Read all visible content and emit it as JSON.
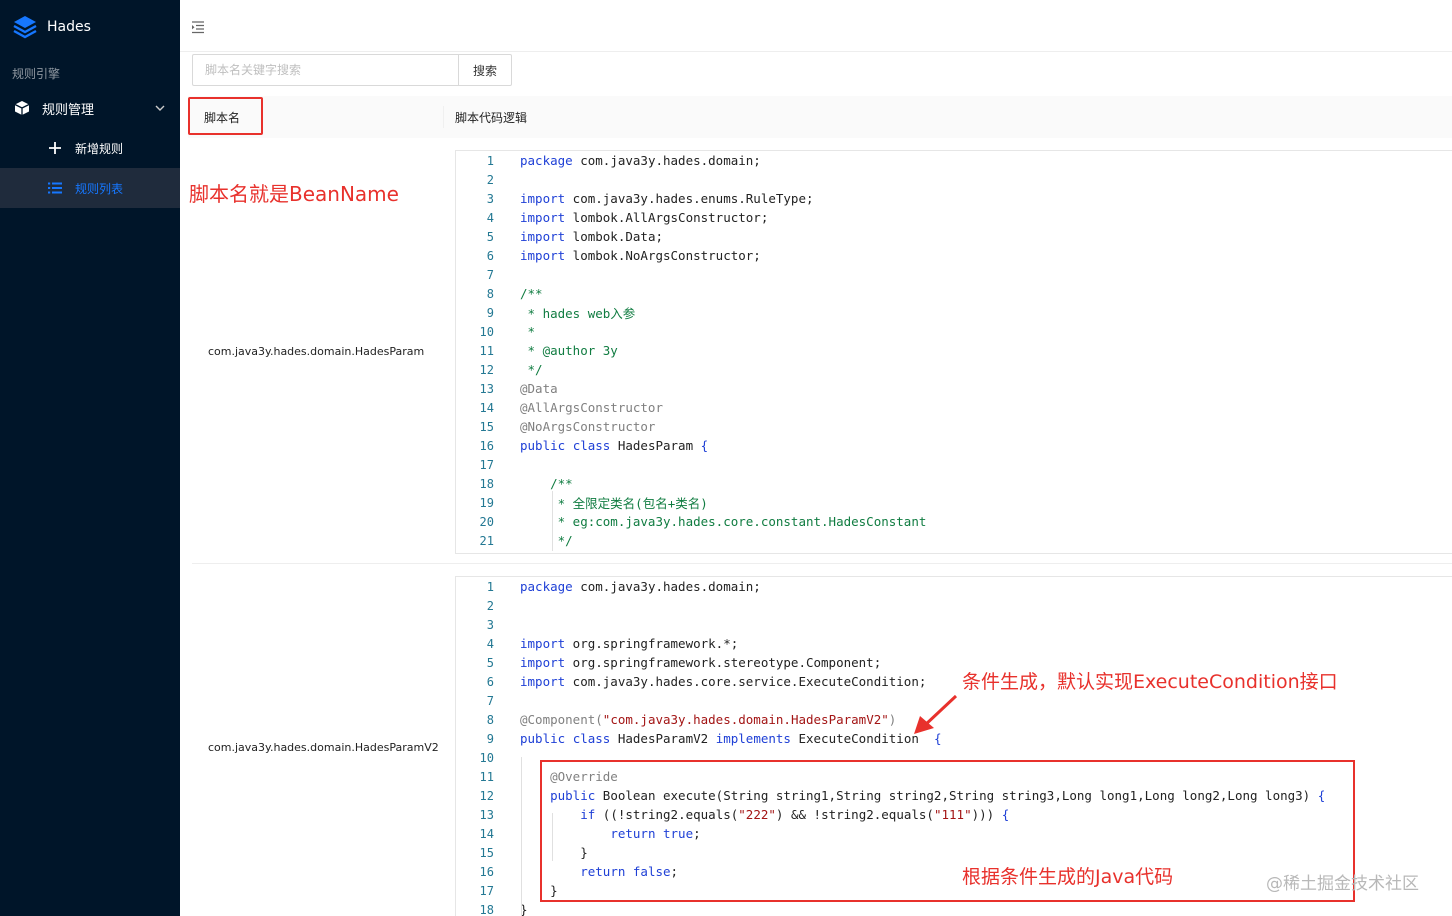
{
  "sidebar": {
    "brand": "Hades",
    "section": "规则引擎",
    "group": "规则管理",
    "items": [
      {
        "label": "新增规则"
      },
      {
        "label": "规则列表"
      }
    ]
  },
  "search": {
    "placeholder": "脚本名关键字搜索",
    "button": "搜索"
  },
  "table": {
    "col_name": "脚本名",
    "col_code": "脚本代码逻辑",
    "rows": [
      {
        "name": "com.java3y.hades.domain.HadesParam",
        "lines": [
          [
            {
              "t": "package",
              "c": "kw"
            },
            {
              "t": " com.java3y.hades.domain;"
            }
          ],
          [],
          [
            {
              "t": "import",
              "c": "kw"
            },
            {
              "t": " com.java3y.hades.enums.RuleType;"
            }
          ],
          [
            {
              "t": "import",
              "c": "kw"
            },
            {
              "t": " lombok.AllArgsConstructor;"
            }
          ],
          [
            {
              "t": "import",
              "c": "kw"
            },
            {
              "t": " lombok.Data;"
            }
          ],
          [
            {
              "t": "import",
              "c": "kw"
            },
            {
              "t": " lombok.NoArgsConstructor;"
            }
          ],
          [],
          [
            {
              "t": "/**",
              "c": "cm"
            }
          ],
          [
            {
              "t": " * hades web入参",
              "c": "cm"
            }
          ],
          [
            {
              "t": " *",
              "c": "cm"
            }
          ],
          [
            {
              "t": " * @author 3y",
              "c": "cm"
            }
          ],
          [
            {
              "t": " */",
              "c": "cm"
            }
          ],
          [
            {
              "t": "@Data",
              "c": "an"
            }
          ],
          [
            {
              "t": "@AllArgsConstructor",
              "c": "an"
            }
          ],
          [
            {
              "t": "@NoArgsConstructor",
              "c": "an"
            }
          ],
          [
            {
              "t": "public",
              "c": "kw"
            },
            {
              "t": " "
            },
            {
              "t": "class",
              "c": "kw"
            },
            {
              "t": " HadesParam "
            },
            {
              "t": "{",
              "c": "kw"
            }
          ],
          [],
          [
            {
              "t": "    /**",
              "c": "cm"
            }
          ],
          [
            {
              "t": "     * 全限定类名(包名+类名)",
              "c": "cm"
            }
          ],
          [
            {
              "t": "     * eg:com.java3y.hades.core.constant.HadesConstant",
              "c": "cm"
            }
          ],
          [
            {
              "t": "     */",
              "c": "cm"
            }
          ]
        ]
      },
      {
        "name": "com.java3y.hades.domain.HadesParamV2",
        "lines": [
          [
            {
              "t": "package",
              "c": "kw"
            },
            {
              "t": " com.java3y.hades.domain;"
            }
          ],
          [],
          [],
          [
            {
              "t": "import",
              "c": "kw"
            },
            {
              "t": " org.springframework.*;"
            }
          ],
          [
            {
              "t": "import",
              "c": "kw"
            },
            {
              "t": " org.springframework.stereotype.Component;"
            }
          ],
          [
            {
              "t": "import",
              "c": "kw"
            },
            {
              "t": " com.java3y.hades.core.service.ExecuteCondition;"
            }
          ],
          [],
          [
            {
              "t": "@Component(",
              "c": "an"
            },
            {
              "t": "\"com.java3y.hades.domain.HadesParamV2\"",
              "c": "st"
            },
            {
              "t": ")",
              "c": "an"
            }
          ],
          [
            {
              "t": "public",
              "c": "kw"
            },
            {
              "t": " "
            },
            {
              "t": "class",
              "c": "kw"
            },
            {
              "t": " HadesParamV2 "
            },
            {
              "t": "implements",
              "c": "kw"
            },
            {
              "t": " ExecuteCondition  "
            },
            {
              "t": "{",
              "c": "kw"
            }
          ],
          [],
          [
            {
              "t": "    @Override",
              "c": "an"
            }
          ],
          [
            {
              "t": "    "
            },
            {
              "t": "public",
              "c": "kw"
            },
            {
              "t": " Boolean execute(String string1,String string2,String string3,Long long1,Long long2,Long long3) "
            },
            {
              "t": "{",
              "c": "kw"
            }
          ],
          [
            {
              "t": "        "
            },
            {
              "t": "if",
              "c": "kw"
            },
            {
              "t": " ((!string2.equals("
            },
            {
              "t": "\"222\"",
              "c": "st"
            },
            {
              "t": ") && !string2.equals("
            },
            {
              "t": "\"111\"",
              "c": "st"
            },
            {
              "t": "))) "
            },
            {
              "t": "{",
              "c": "kw"
            }
          ],
          [
            {
              "t": "            "
            },
            {
              "t": "return",
              "c": "kw"
            },
            {
              "t": " "
            },
            {
              "t": "true",
              "c": "kw"
            },
            {
              "t": ";"
            }
          ],
          [
            {
              "t": "        }"
            }
          ],
          [
            {
              "t": "        "
            },
            {
              "t": "return",
              "c": "kw"
            },
            {
              "t": " "
            },
            {
              "t": "false",
              "c": "kw"
            },
            {
              "t": ";"
            }
          ],
          [
            {
              "t": "    }"
            }
          ],
          [
            {
              "t": "}"
            }
          ]
        ]
      }
    ]
  },
  "annotations": {
    "bean_name": "脚本名就是BeanName",
    "condition": "条件生成，默认实现ExecuteCondition接口",
    "java_code": "根据条件生成的Java代码"
  },
  "watermark": "@稀土掘金技术社区",
  "colors": {
    "sidebar_bg": "#001529",
    "accent": "#1677ff",
    "annotation_red": "#e8312c",
    "keyword": "#1f40d6",
    "comment": "#107c41"
  }
}
